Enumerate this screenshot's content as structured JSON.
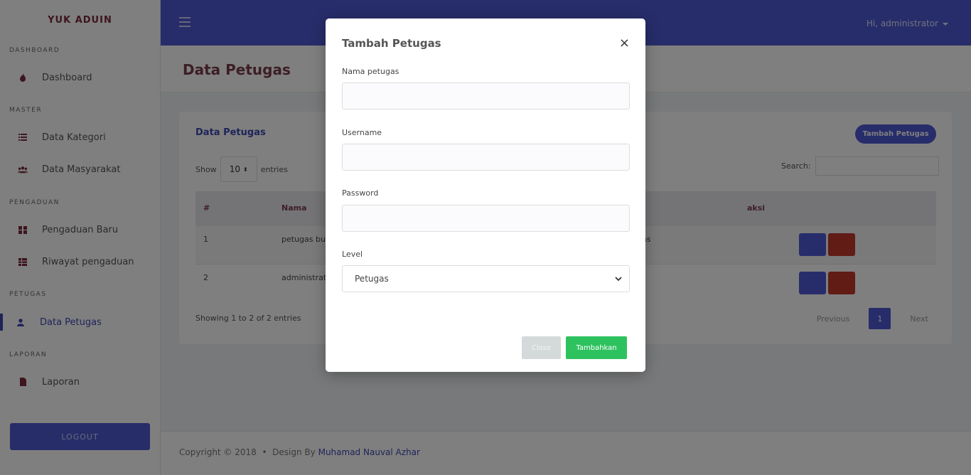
{
  "sidebar": {
    "brand": "YUK ADUIN",
    "sections": {
      "dashboard": "DASHBOARD",
      "master": "MASTER",
      "pengaduan": "PENGADUAN",
      "petugas": "PETUGAS",
      "laporan": "LAPORAN"
    },
    "items": [
      {
        "label": "Dashboard",
        "icon": "fire-icon"
      },
      {
        "label": "Data Kategori",
        "icon": "list-icon"
      },
      {
        "label": "Data Masyarakat",
        "icon": "users-icon"
      },
      {
        "label": "Pengaduan Baru",
        "icon": "grid-icon"
      },
      {
        "label": "Riwayat pengaduan",
        "icon": "table-icon"
      },
      {
        "label": "Data Petugas",
        "icon": "user-icon"
      },
      {
        "label": "Laporan",
        "icon": "file-icon"
      }
    ],
    "logout": "LOGOUT"
  },
  "topbar": {
    "user": "Hi, administrator"
  },
  "page": {
    "title": "Data Petugas"
  },
  "card": {
    "title": "Data Petugas",
    "add_button": "Tambah Petugas",
    "show_label": "Show",
    "entries_value": "10",
    "entries_label": "entries",
    "search_label": "Search:",
    "columns": [
      "#",
      "Nama",
      "",
      "l",
      "aksi"
    ],
    "rows": [
      {
        "no": "1",
        "nama": "petugas bu",
        "level": "gas"
      },
      {
        "no": "2",
        "nama": "administrat",
        "level": "n"
      }
    ],
    "info": "Showing 1 to 2 of 2 entries",
    "pager": {
      "prev": "Previous",
      "page": "1",
      "next": "Next"
    }
  },
  "footer": {
    "copyright": "Copyright © 2018",
    "sep": "•",
    "design_by": "Design By",
    "author": "Muhamad Nauval Azhar"
  },
  "modal": {
    "title": "Tambah Petugas",
    "close_glyph": "×",
    "fields": {
      "nama": {
        "label": "Nama petugas",
        "value": ""
      },
      "username": {
        "label": "Username",
        "value": ""
      },
      "password": {
        "label": "Password",
        "value": ""
      },
      "level": {
        "label": "Level",
        "value": "Petugas"
      }
    },
    "close_button": "Close",
    "submit_button": "Tambahkan"
  },
  "colors": {
    "primary": "#4e5ad4",
    "success": "#2ec25f",
    "danger": "#c0392b",
    "brand": "#7b2b3c"
  }
}
